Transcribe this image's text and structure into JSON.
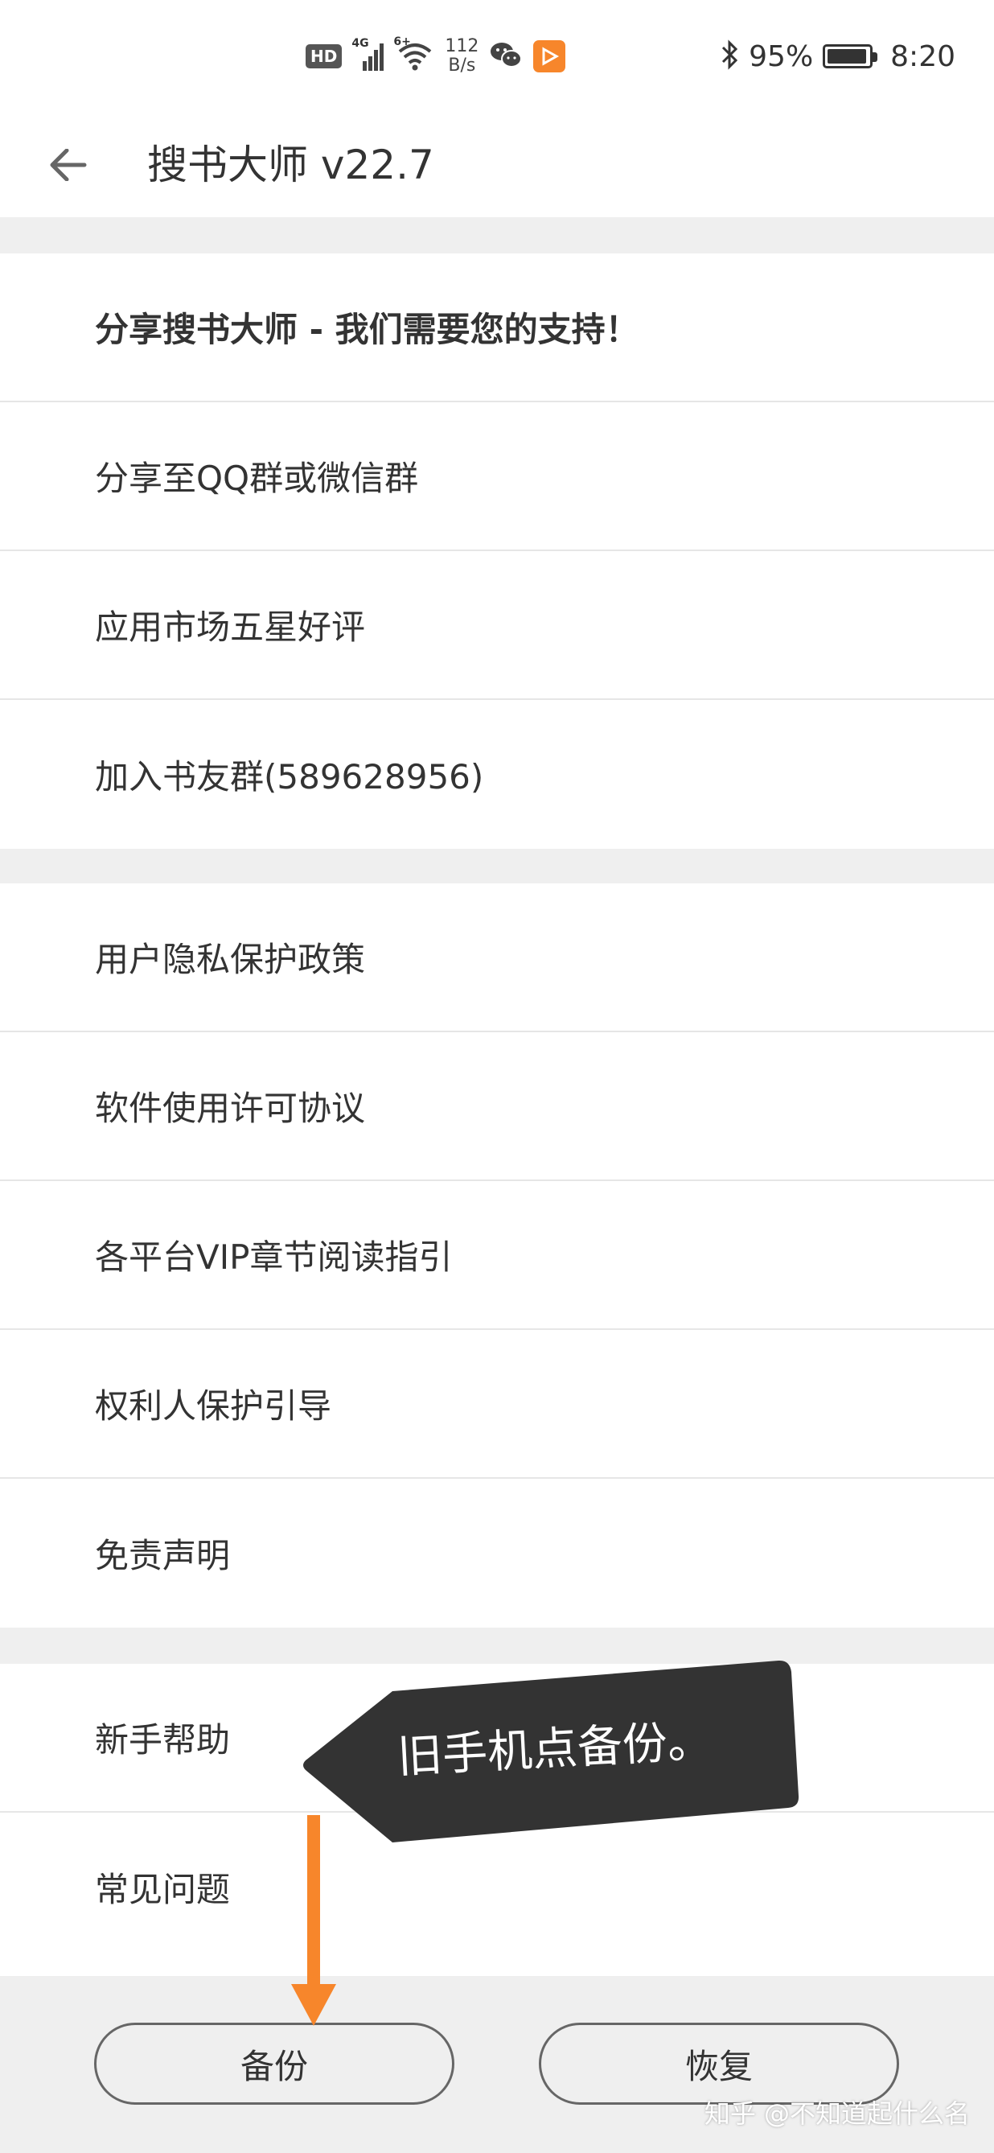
{
  "status_bar": {
    "hd": "HD",
    "net_type": "4G",
    "wifi_type": "6+",
    "speed_value": "112",
    "speed_unit": "B/s",
    "battery_text": "95%",
    "battery_level": 0.95,
    "time": "8:20"
  },
  "toolbar": {
    "title": "搜书大师 v22.7"
  },
  "groups": [
    {
      "items": [
        {
          "label": "分享搜书大师 - 我们需要您的支持！"
        },
        {
          "label": "分享至QQ群或微信群"
        },
        {
          "label": "应用市场五星好评"
        },
        {
          "label": "加入书友群(589628956)"
        }
      ]
    },
    {
      "items": [
        {
          "label": "用户隐私保护政策"
        },
        {
          "label": "软件使用许可协议"
        },
        {
          "label": "各平台VIP章节阅读指引"
        },
        {
          "label": "权利人保护引导"
        },
        {
          "label": "免责声明"
        }
      ]
    },
    {
      "items": [
        {
          "label": "新手帮助"
        },
        {
          "label": "常见问题"
        }
      ]
    }
  ],
  "bottom": {
    "backup_label": "备份",
    "restore_label": "恢复",
    "watermark": "知乎 @不知道起什么名"
  },
  "annotation": {
    "callout_text": "旧手机点备份。",
    "arrow_color": "#f7862b",
    "callout_color": "#333333"
  }
}
